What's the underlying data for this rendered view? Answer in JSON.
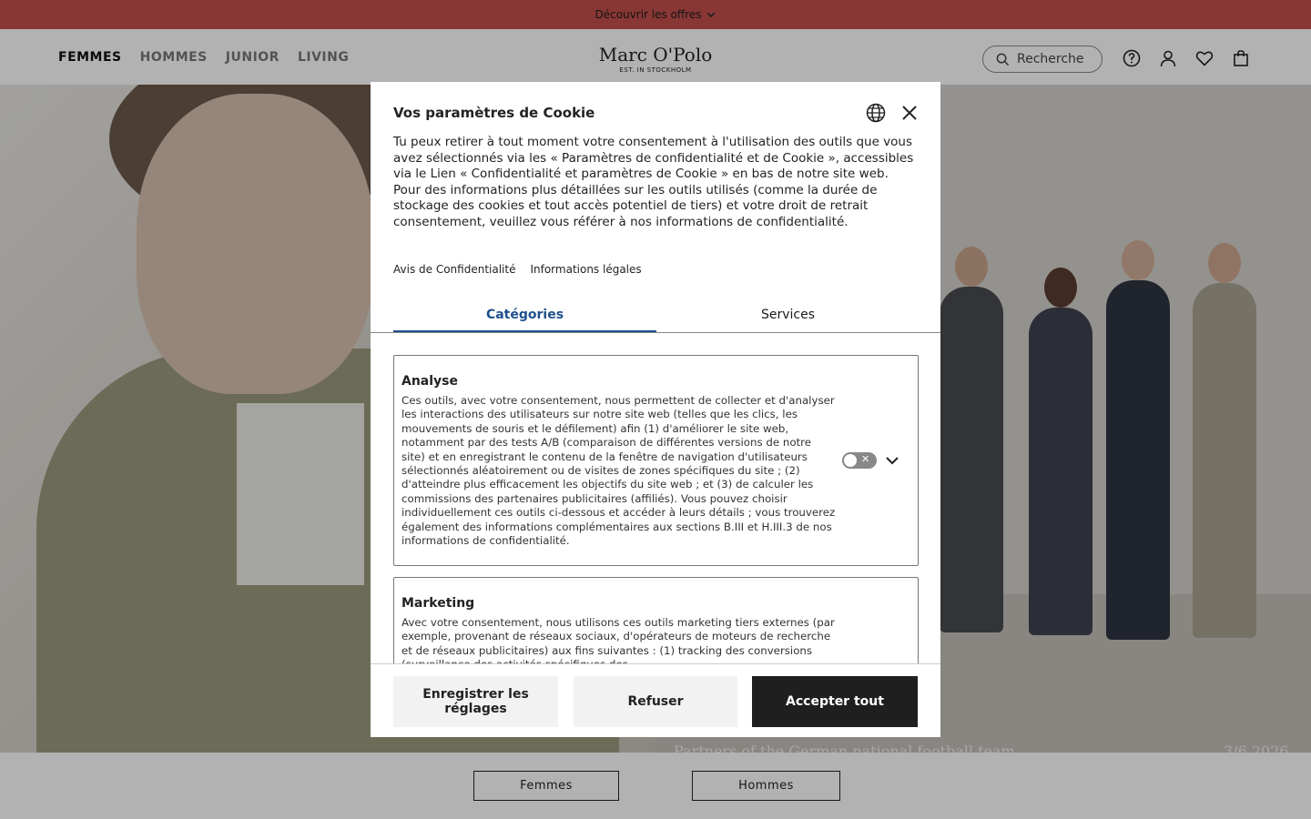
{
  "promo": {
    "text": "Découvrir les offres",
    "icon": "chevron-down-icon"
  },
  "header": {
    "nav": [
      "FEMMES",
      "HOMMES",
      "JUNIOR",
      "LIVING"
    ],
    "active_nav": "FEMMES",
    "logo_name": "Marc O'Polo",
    "logo_tagline": "EST. IN STOCKHOLM",
    "search_placeholder": "Recherche",
    "icons": [
      "help-icon",
      "user-icon",
      "heart-icon",
      "bag-icon"
    ]
  },
  "hero": {
    "caption": "Partners of the German national football team",
    "date": "3/6 2026"
  },
  "categories": {
    "women": "Femmes",
    "men": "Hommes"
  },
  "cookie_modal": {
    "title": "Vos paramètres de Cookie",
    "body": "Tu peux retirer à tout moment votre consentement à l'utilisation des outils que vous avez sélectionnés via les « Paramètres de confidentialité et de Cookie », accessibles via le Lien « Confidentialité et paramètres de Cookie » en bas de notre site web. Pour des informations plus détaillées sur les outils utilisés (comme la durée de stockage des cookies et tout accès potentiel de tiers) et votre droit de retrait consentement, veuillez vous référer à nos informations de confidentialité.",
    "links": [
      "Avis de Confidentialité",
      "Informations légales"
    ],
    "tabs": [
      "Catégories",
      "Services"
    ],
    "active_tab": "Catégories",
    "cards": [
      {
        "title": "Analyse",
        "description": "Ces outils, avec votre consentement, nous permettent de collecter et d'analyser les interactions des utilisateurs sur notre site web (telles que les clics, les mouvements de souris et le défilement) afin (1) d'améliorer le site web, notamment par des tests A/B (comparaison de différentes versions de notre site) et en enregistrant le contenu de la fenêtre de navigation d'utilisateurs sélectionnés aléatoirement ou de visites de zones spécifiques du site ; (2) d'atteindre plus efficacement les objectifs du site web ; et (3) de calculer les commissions des partenaires publicitaires (affiliés). Vous pouvez choisir individuellement ces outils ci-dessous et accéder à leurs détails ; vous trouverez également des informations complémentaires aux sections B.III et H.III.3 de nos informations de confidentialité.",
        "enabled": false
      },
      {
        "title": "Marketing",
        "description": "Avec votre consentement, nous utilisons ces outils marketing tiers externes (par exemple, provenant de réseaux sociaux, d'opérateurs de moteurs de recherche et de réseaux publicitaires) aux fins suivantes : (1) tracking des conversions (surveillance des activités spécifiques des",
        "enabled": false
      }
    ],
    "buttons": {
      "save": "Enregistrer les réglages",
      "refuse": "Refuser",
      "accept": "Accepter tout"
    }
  }
}
